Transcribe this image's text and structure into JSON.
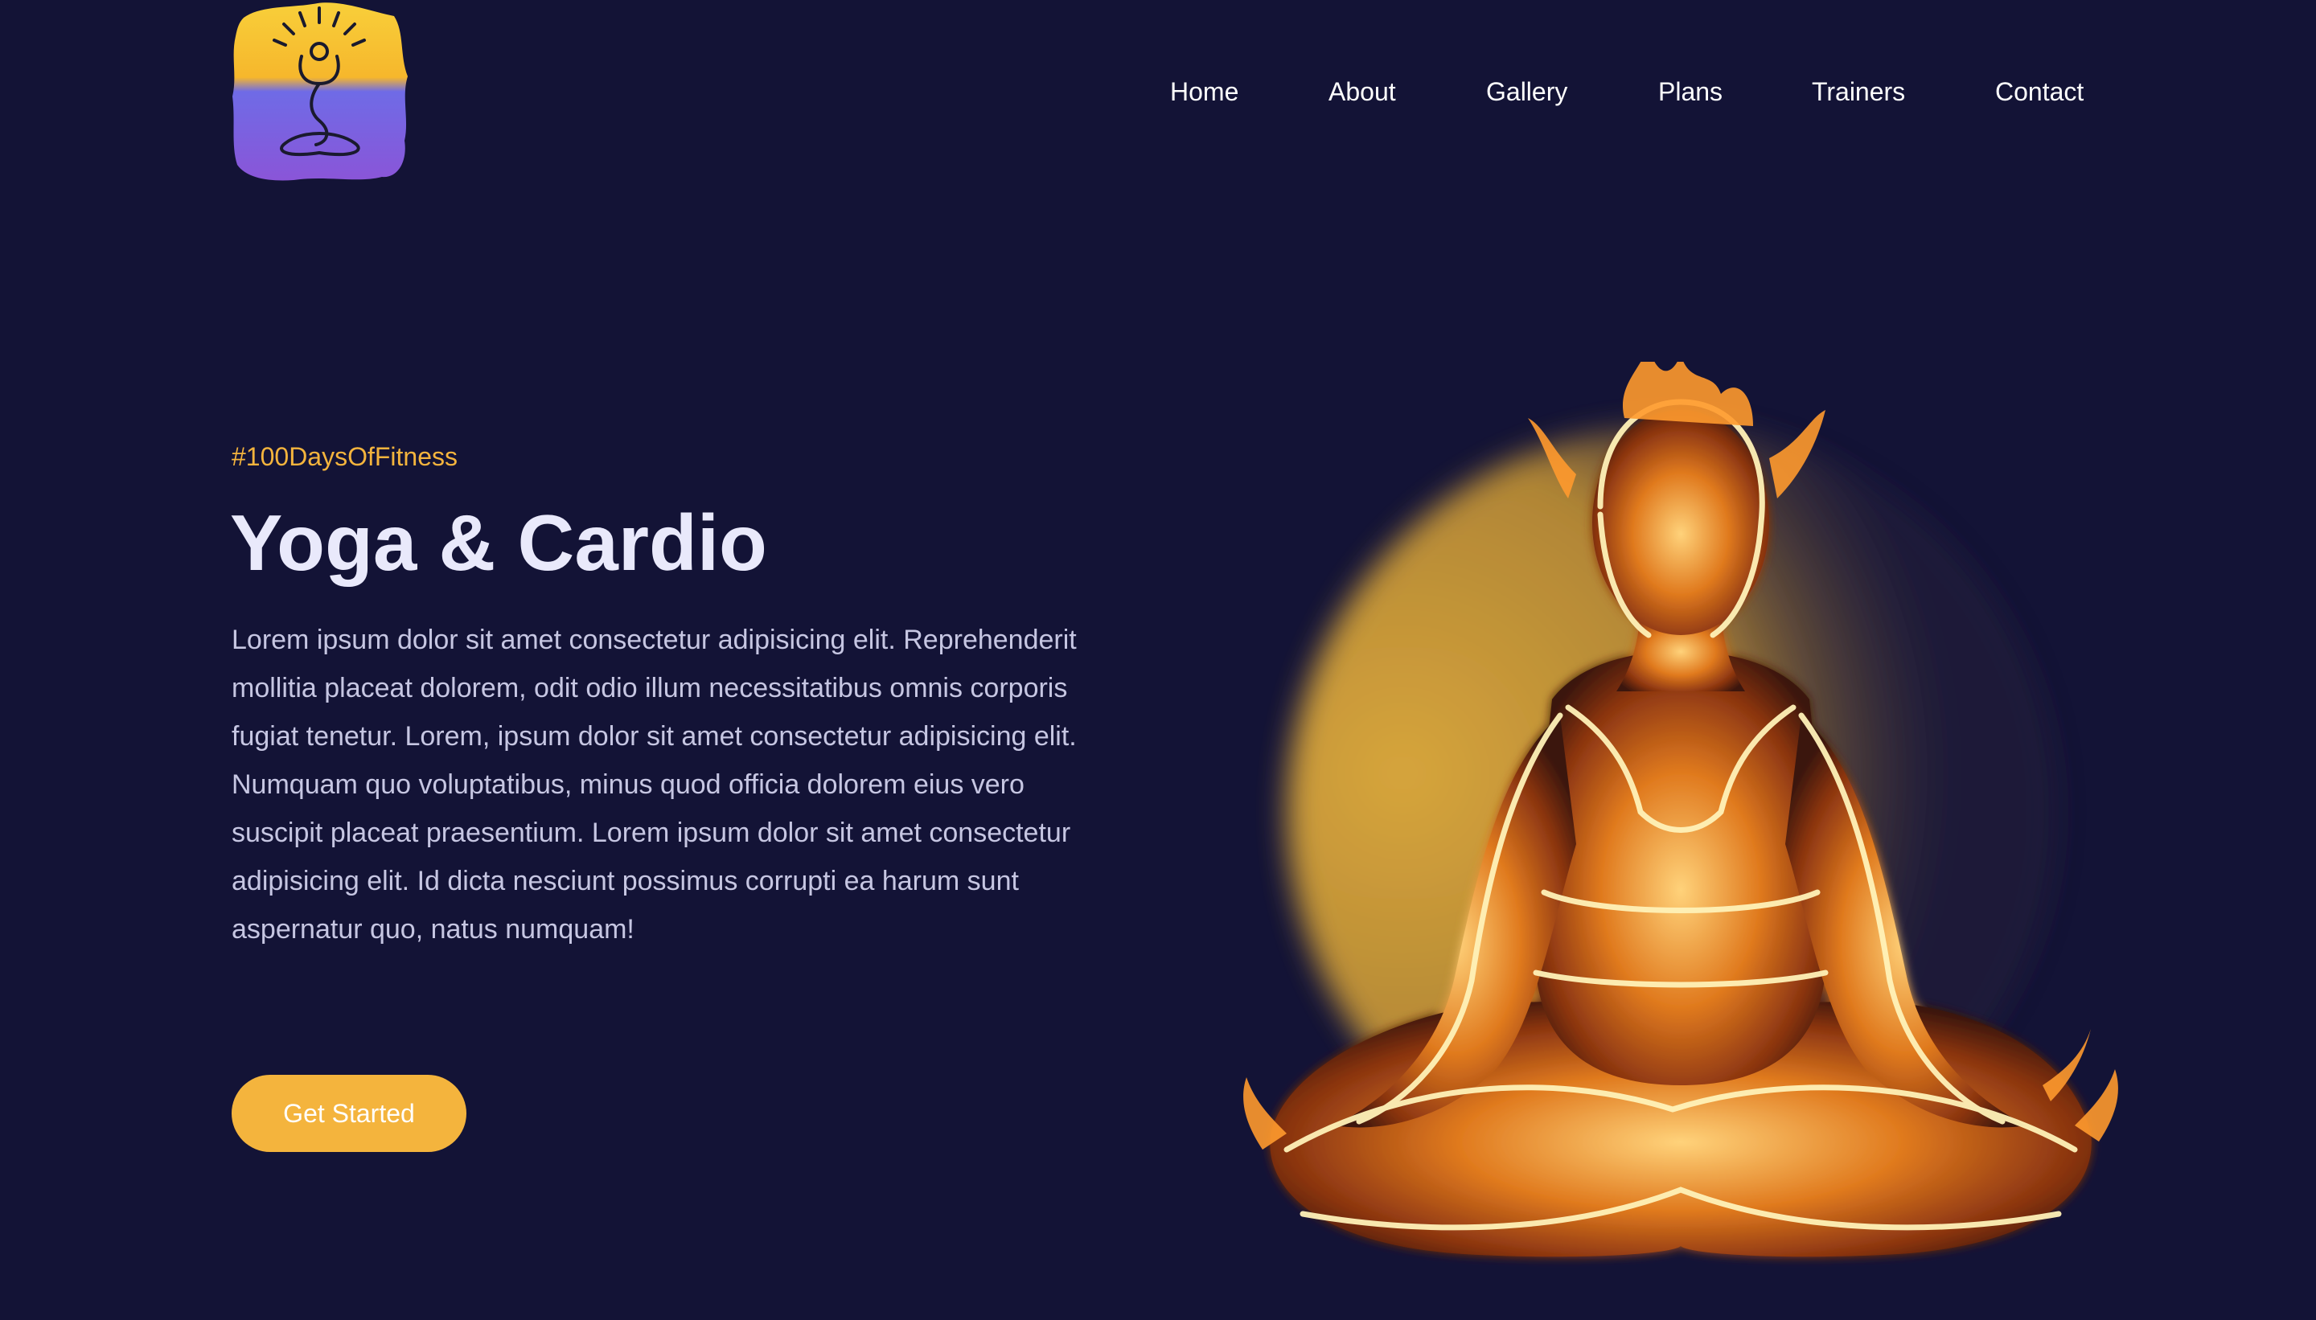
{
  "nav": {
    "items": [
      "Home",
      "About",
      "Gallery",
      "Plans",
      "Trainers",
      "Contact"
    ]
  },
  "logo": {
    "icon": "meditating-person-icon",
    "colors": [
      "#f6c22c",
      "#5b5ee0",
      "#8a4fd6"
    ]
  },
  "hero": {
    "tag": "#100DaysOfFitness",
    "title": "Yoga & Cardio",
    "description": "Lorem ipsum dolor sit amet consectetur adipisicing elit. Reprehenderit mollitia placeat dolorem, odit odio illum necessitatibus omnis corporis fugiat tenetur. Lorem, ipsum dolor sit amet consectetur adipisicing elit. Numquam quo voluptatibus, minus quod officia dolorem eius vero suscipit placeat praesentium. Lorem ipsum dolor sit amet consectetur adipisicing elit. Id dicta nesciunt possimus corrupti ea harum sunt aspernatur quo, natus numquam!",
    "cta_label": "Get Started",
    "image": "fire-yoga-meditation-figure"
  },
  "colors": {
    "background": "#131336",
    "accent": "#f4b43d",
    "title": "#e9e9fb",
    "text": "#c6c6e2"
  }
}
